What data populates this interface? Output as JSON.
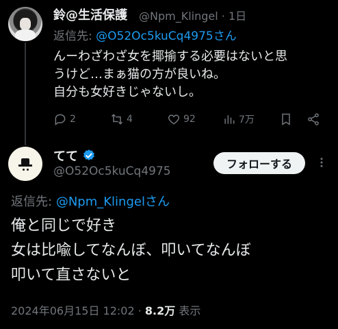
{
  "first_tweet": {
    "display_name": "鈴@生活保護",
    "handle": "@Npm_Klingel",
    "separator": "·",
    "time": "1日",
    "reply_prefix": "返信先:",
    "reply_to": "@O52Oc5kuCq4975さん",
    "text_lines": [
      "んーわざわざ女を揶揄する必要はないと思",
      "うけど…まぁ猫の方が良いね。",
      "自分も女好きじゃないし。"
    ],
    "actions": {
      "replies": "2",
      "reposts": "4",
      "likes": "92",
      "views": "7万"
    }
  },
  "second_tweet": {
    "display_name": "てて",
    "handle": "@O52Oc5kuCq4975",
    "follow_label": "フォローする",
    "reply_prefix": "返信先:",
    "reply_to": "@Npm_Klingelさん",
    "text_lines": [
      "俺と同じで好き",
      "女は比喩してなんぼ、叩いてなんぼ",
      "叩いて直さないと"
    ],
    "timestamp": "2024年06月15日 12:02",
    "separator": "·",
    "views_count": "8.2万",
    "views_label": "表示"
  },
  "colors": {
    "background": "#000000",
    "text": "#e7e9ea",
    "muted": "#71767b",
    "link": "#1d9bf0",
    "verified": "#1d9bf0"
  }
}
